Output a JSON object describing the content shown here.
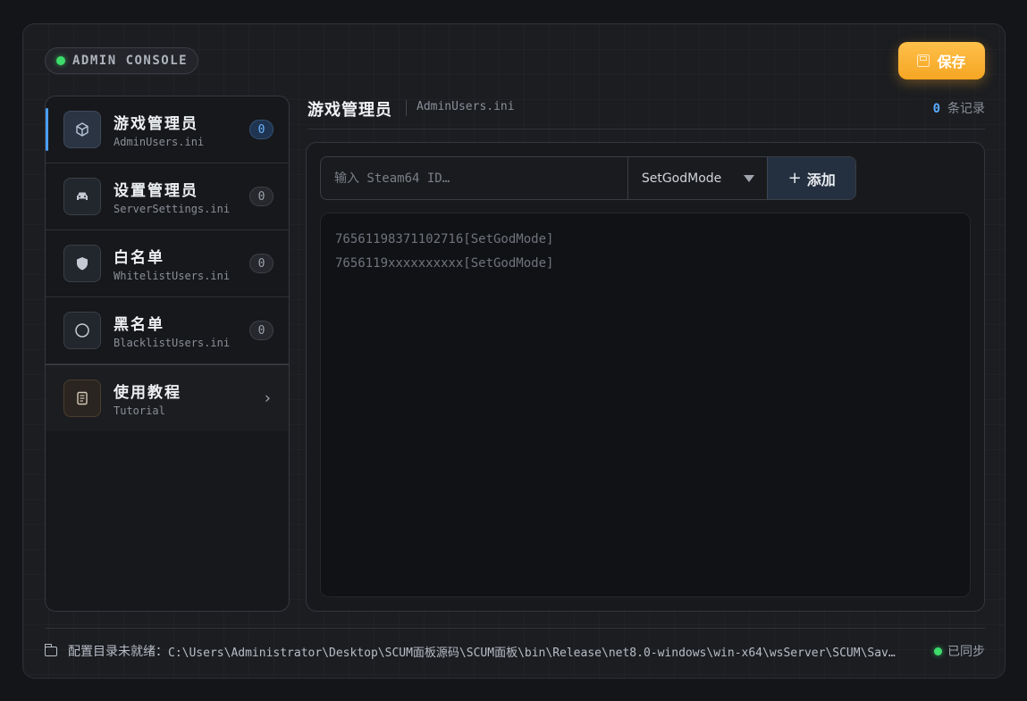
{
  "header": {
    "console_label": "ADMIN CONSOLE",
    "save_label": "保存"
  },
  "sidebar": {
    "items": [
      {
        "title": "游戏管理员",
        "file": "AdminUsers.ini",
        "count": "0",
        "icon": "cube-icon",
        "active": true
      },
      {
        "title": "设置管理员",
        "file": "ServerSettings.ini",
        "count": "0",
        "icon": "car-icon"
      },
      {
        "title": "白名单",
        "file": "WhitelistUsers.ini",
        "count": "0",
        "icon": "shield-icon"
      },
      {
        "title": "黑名单",
        "file": "BlacklistUsers.ini",
        "count": "0",
        "icon": "circle-icon"
      },
      {
        "title": "使用教程",
        "file": "Tutorial",
        "icon": "document-icon"
      }
    ]
  },
  "main": {
    "title": "游戏管理员",
    "file": "AdminUsers.ini",
    "record_count": "0",
    "record_label": "条记录",
    "input_placeholder": "输入 Steam64 ID…",
    "selected_permission": "SetGodMode",
    "add_label": "添加",
    "editor_lines": [
      "76561198371102716[SetGodMode]",
      "7656119xxxxxxxxxx[SetGodMode]"
    ]
  },
  "footer": {
    "path_label": "配置目录未就绪：",
    "path_value": "C:\\Users\\Administrator\\Desktop\\SCUM面板源码\\SCUM面板\\bin\\Release\\net8.0-windows\\win-x64\\wsServer\\SCUM\\Saved\\Config\\WindowsServer",
    "sync_status": "已同步"
  },
  "colors": {
    "accent_blue": "#4a9eff",
    "save_orange": "#f5a623",
    "status_green": "#3ddc6b"
  }
}
